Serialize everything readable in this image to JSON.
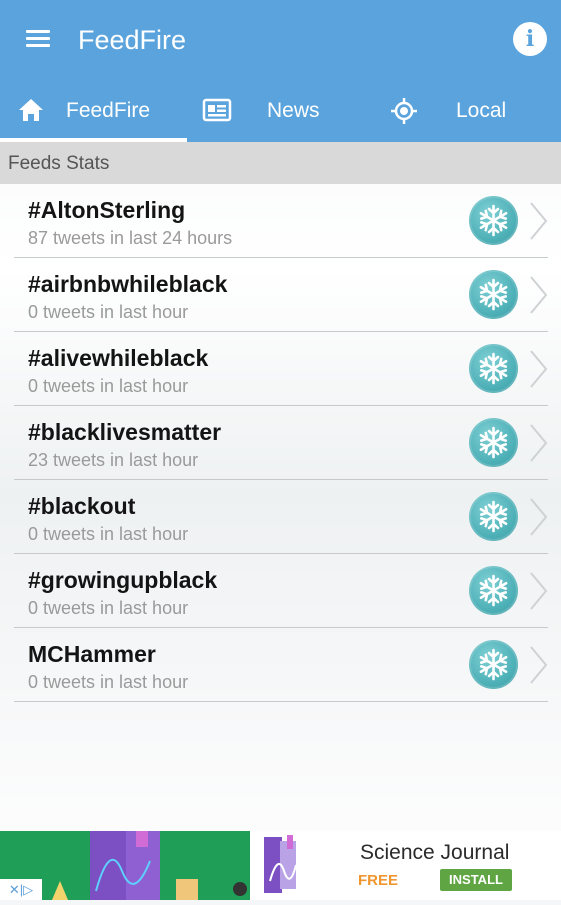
{
  "app": {
    "title": "FeedFire"
  },
  "tabs": [
    {
      "label": "FeedFire",
      "icon": "home-icon",
      "selected": true
    },
    {
      "label": "News",
      "icon": "newspaper-icon",
      "selected": false
    },
    {
      "label": "Local",
      "icon": "location-target-icon",
      "selected": false
    }
  ],
  "section": {
    "header": "Feeds Stats"
  },
  "feeds": [
    {
      "name": "#AltonSterling",
      "stats": "87 tweets in last 24 hours",
      "icon": "snowflake-icon"
    },
    {
      "name": "#airbnbwhileblack",
      "stats": "0 tweets in last hour",
      "icon": "snowflake-icon"
    },
    {
      "name": "#alivewhileblack",
      "stats": "0 tweets in last hour",
      "icon": "snowflake-icon"
    },
    {
      "name": "#blacklivesmatter",
      "stats": "23 tweets in last hour",
      "icon": "snowflake-icon"
    },
    {
      "name": "#blackout",
      "stats": "0 tweets in last hour",
      "icon": "snowflake-icon"
    },
    {
      "name": "#growingupblack",
      "stats": "0 tweets in last hour",
      "icon": "snowflake-icon"
    },
    {
      "name": "MCHammer",
      "stats": "0 tweets in last hour",
      "icon": "snowflake-icon"
    }
  ],
  "ad": {
    "title": "Science Journal",
    "price": "FREE",
    "install_label": "INSTALL"
  },
  "colors": {
    "appbar": "#5aa3dc",
    "section_header": "#d9d9d9",
    "badge": "#4fb1b8",
    "ad_price": "#f0962e",
    "ad_install": "#5fa544"
  }
}
